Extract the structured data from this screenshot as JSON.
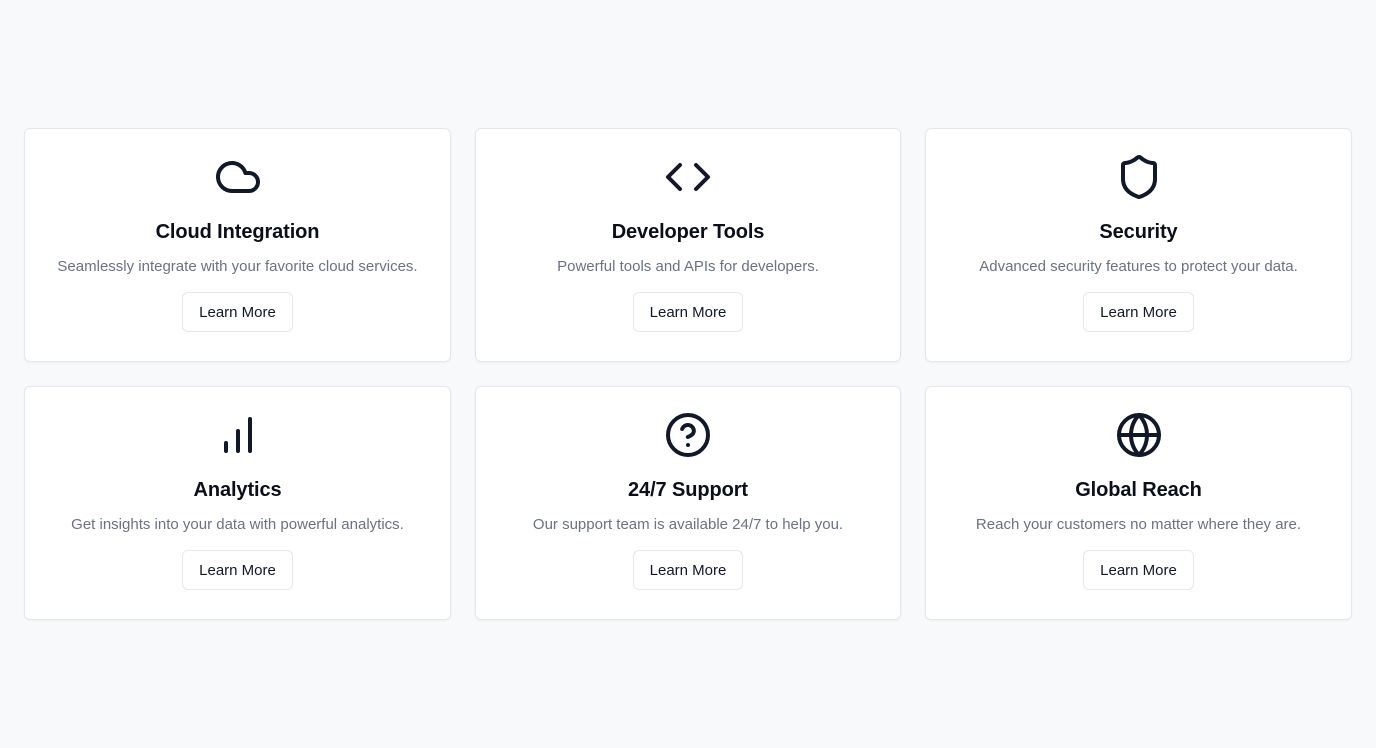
{
  "colors": {
    "background": "#f8f9fb",
    "card": "#ffffff",
    "border": "#e5e7eb",
    "title": "#0b0f19",
    "description": "#6b7280",
    "icon": "#111827"
  },
  "features": [
    {
      "icon": "cloud-icon",
      "title": "Cloud Integration",
      "description": "Seamlessly integrate with your favorite cloud services.",
      "button_label": "Learn More"
    },
    {
      "icon": "code-icon",
      "title": "Developer Tools",
      "description": "Powerful tools and APIs for developers.",
      "button_label": "Learn More"
    },
    {
      "icon": "shield-icon",
      "title": "Security",
      "description": "Advanced security features to protect your data.",
      "button_label": "Learn More"
    },
    {
      "icon": "bar-chart-icon",
      "title": "Analytics",
      "description": "Get insights into your data with powerful analytics.",
      "button_label": "Learn More"
    },
    {
      "icon": "help-circle-icon",
      "title": "24/7 Support",
      "description": "Our support team is available 24/7 to help you.",
      "button_label": "Learn More"
    },
    {
      "icon": "globe-icon",
      "title": "Global Reach",
      "description": "Reach your customers no matter where they are.",
      "button_label": "Learn More"
    }
  ]
}
